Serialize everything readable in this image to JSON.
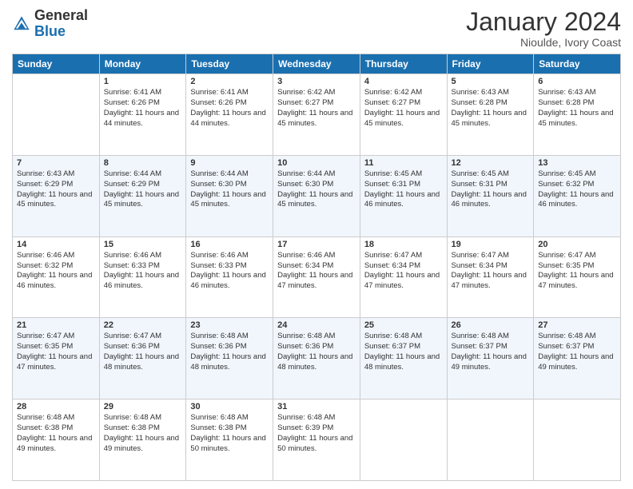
{
  "header": {
    "logo_general": "General",
    "logo_blue": "Blue",
    "month_title": "January 2024",
    "location": "Nioulde, Ivory Coast"
  },
  "days": [
    "Sunday",
    "Monday",
    "Tuesday",
    "Wednesday",
    "Thursday",
    "Friday",
    "Saturday"
  ],
  "weeks": [
    [
      {
        "date": "",
        "info": ""
      },
      {
        "date": "1",
        "info": "Sunrise: 6:41 AM\nSunset: 6:26 PM\nDaylight: 11 hours and 44 minutes."
      },
      {
        "date": "2",
        "info": "Sunrise: 6:41 AM\nSunset: 6:26 PM\nDaylight: 11 hours and 44 minutes."
      },
      {
        "date": "3",
        "info": "Sunrise: 6:42 AM\nSunset: 6:27 PM\nDaylight: 11 hours and 45 minutes."
      },
      {
        "date": "4",
        "info": "Sunrise: 6:42 AM\nSunset: 6:27 PM\nDaylight: 11 hours and 45 minutes."
      },
      {
        "date": "5",
        "info": "Sunrise: 6:43 AM\nSunset: 6:28 PM\nDaylight: 11 hours and 45 minutes."
      },
      {
        "date": "6",
        "info": "Sunrise: 6:43 AM\nSunset: 6:28 PM\nDaylight: 11 hours and 45 minutes."
      }
    ],
    [
      {
        "date": "7",
        "info": "Sunrise: 6:43 AM\nSunset: 6:29 PM\nDaylight: 11 hours and 45 minutes."
      },
      {
        "date": "8",
        "info": "Sunrise: 6:44 AM\nSunset: 6:29 PM\nDaylight: 11 hours and 45 minutes."
      },
      {
        "date": "9",
        "info": "Sunrise: 6:44 AM\nSunset: 6:30 PM\nDaylight: 11 hours and 45 minutes."
      },
      {
        "date": "10",
        "info": "Sunrise: 6:44 AM\nSunset: 6:30 PM\nDaylight: 11 hours and 45 minutes."
      },
      {
        "date": "11",
        "info": "Sunrise: 6:45 AM\nSunset: 6:31 PM\nDaylight: 11 hours and 46 minutes."
      },
      {
        "date": "12",
        "info": "Sunrise: 6:45 AM\nSunset: 6:31 PM\nDaylight: 11 hours and 46 minutes."
      },
      {
        "date": "13",
        "info": "Sunrise: 6:45 AM\nSunset: 6:32 PM\nDaylight: 11 hours and 46 minutes."
      }
    ],
    [
      {
        "date": "14",
        "info": "Sunrise: 6:46 AM\nSunset: 6:32 PM\nDaylight: 11 hours and 46 minutes."
      },
      {
        "date": "15",
        "info": "Sunrise: 6:46 AM\nSunset: 6:33 PM\nDaylight: 11 hours and 46 minutes."
      },
      {
        "date": "16",
        "info": "Sunrise: 6:46 AM\nSunset: 6:33 PM\nDaylight: 11 hours and 46 minutes."
      },
      {
        "date": "17",
        "info": "Sunrise: 6:46 AM\nSunset: 6:34 PM\nDaylight: 11 hours and 47 minutes."
      },
      {
        "date": "18",
        "info": "Sunrise: 6:47 AM\nSunset: 6:34 PM\nDaylight: 11 hours and 47 minutes."
      },
      {
        "date": "19",
        "info": "Sunrise: 6:47 AM\nSunset: 6:34 PM\nDaylight: 11 hours and 47 minutes."
      },
      {
        "date": "20",
        "info": "Sunrise: 6:47 AM\nSunset: 6:35 PM\nDaylight: 11 hours and 47 minutes."
      }
    ],
    [
      {
        "date": "21",
        "info": "Sunrise: 6:47 AM\nSunset: 6:35 PM\nDaylight: 11 hours and 47 minutes."
      },
      {
        "date": "22",
        "info": "Sunrise: 6:47 AM\nSunset: 6:36 PM\nDaylight: 11 hours and 48 minutes."
      },
      {
        "date": "23",
        "info": "Sunrise: 6:48 AM\nSunset: 6:36 PM\nDaylight: 11 hours and 48 minutes."
      },
      {
        "date": "24",
        "info": "Sunrise: 6:48 AM\nSunset: 6:36 PM\nDaylight: 11 hours and 48 minutes."
      },
      {
        "date": "25",
        "info": "Sunrise: 6:48 AM\nSunset: 6:37 PM\nDaylight: 11 hours and 48 minutes."
      },
      {
        "date": "26",
        "info": "Sunrise: 6:48 AM\nSunset: 6:37 PM\nDaylight: 11 hours and 49 minutes."
      },
      {
        "date": "27",
        "info": "Sunrise: 6:48 AM\nSunset: 6:37 PM\nDaylight: 11 hours and 49 minutes."
      }
    ],
    [
      {
        "date": "28",
        "info": "Sunrise: 6:48 AM\nSunset: 6:38 PM\nDaylight: 11 hours and 49 minutes."
      },
      {
        "date": "29",
        "info": "Sunrise: 6:48 AM\nSunset: 6:38 PM\nDaylight: 11 hours and 49 minutes."
      },
      {
        "date": "30",
        "info": "Sunrise: 6:48 AM\nSunset: 6:38 PM\nDaylight: 11 hours and 50 minutes."
      },
      {
        "date": "31",
        "info": "Sunrise: 6:48 AM\nSunset: 6:39 PM\nDaylight: 11 hours and 50 minutes."
      },
      {
        "date": "",
        "info": ""
      },
      {
        "date": "",
        "info": ""
      },
      {
        "date": "",
        "info": ""
      }
    ]
  ]
}
